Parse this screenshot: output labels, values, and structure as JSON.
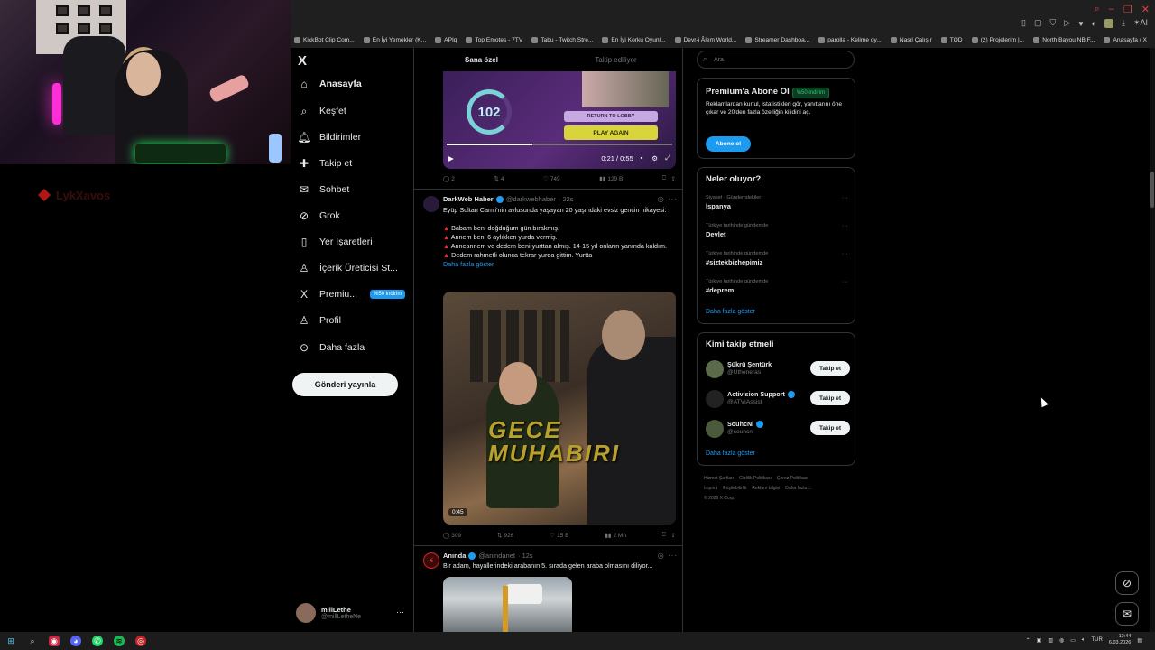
{
  "browser": {
    "bookmarks": [
      "KickBot Clip Com...",
      "En İyi Yemekler (K...",
      "APIq",
      "Top Emotes - 7TV",
      "Tabu - Twitch Stre...",
      "En İyi Korku Oyunl...",
      "Devr-i Âlem World...",
      "Streamer Dashboa...",
      "parolla - Kelime oy...",
      "Nasıl Çalışır",
      "TOD",
      "(2) Projelerim |...",
      "North Bayou NB F...",
      "Anasayfa / X"
    ]
  },
  "stream": {
    "logo_text": "LykXavos"
  },
  "nav": {
    "logo": "X",
    "items": [
      {
        "label": "Anasayfa",
        "icon": "home-icon"
      },
      {
        "label": "Keşfet",
        "icon": "search-icon"
      },
      {
        "label": "Bildirimler",
        "icon": "bell-icon"
      },
      {
        "label": "Takip et",
        "icon": "follow-icon"
      },
      {
        "label": "Sohbet",
        "icon": "mail-icon"
      },
      {
        "label": "Grok",
        "icon": "grok-icon"
      },
      {
        "label": "Yer İşaretleri",
        "icon": "bookmark-icon"
      },
      {
        "label": "İçerik Üreticisi St...",
        "icon": "creator-icon"
      },
      {
        "label": "Premiu...",
        "icon": "x-icon",
        "badge": "%50 indirim"
      },
      {
        "label": "Profil",
        "icon": "profile-icon"
      },
      {
        "label": "Daha fazla",
        "icon": "more-icon"
      }
    ],
    "post_button": "Gönderi yayınla",
    "account": {
      "name": "millLethe",
      "handle": "@millLetheNe",
      "more": "···"
    }
  },
  "feed": {
    "tabs": [
      {
        "label": "Sana özel",
        "active": true
      },
      {
        "label": "Takip ediliyor",
        "active": false
      }
    ],
    "video1": {
      "score": "102",
      "return_label": "RETURN TO LOBBY",
      "play_label": "PLAY AGAIN",
      "time": "0:21 / 0:55",
      "progress": 0.38
    },
    "post1_actions": {
      "replies": "2",
      "reposts": "4",
      "likes": "749",
      "views": "129 B"
    },
    "post2": {
      "name": "DarkWeb Haber",
      "handle": "@darkwebhaber",
      "time": "· 22s",
      "text_intro": "Eyüp Sultan Camii'nin avlusunda yaşayan 20 yaşındaki evsiz gencin hikayesi:",
      "lines": [
        "Babam beni doğduğum gün bırakmış.",
        "Annem beni 6 aylıkken yurda vermiş.",
        "Anneannem ve dedem beni yurttan almış. 14-15 yıl onların yanında kaldım.",
        "Dedem rahmetli olunca tekrar yurda gittim. Yurtta"
      ],
      "more": "Daha fazla göster",
      "video_title": "GECE MUHABIRI",
      "video_time": "0:45",
      "actions": {
        "replies": "309",
        "reposts": "926",
        "likes": "15 B",
        "views": "2 Mn"
      }
    },
    "post3": {
      "name": "Anında",
      "handle": "@anindanet",
      "time": "· 12s",
      "text": "Bir adam, hayallerindeki arabanın 5. sırada gelen araba olmasını diliyor..."
    }
  },
  "sidebar": {
    "search_placeholder": "Ara",
    "premium": {
      "title": "Premium'a Abone Ol",
      "badge": "%50 indirim",
      "text": "Reklamlardan kurtul, istatistikleri gör, yanıtlarını öne çıkar ve 20'den fazla özelliğin kilidini aç.",
      "button": "Abone ol"
    },
    "trends": {
      "title": "Neler oluyor?",
      "items": [
        {
          "context": "Siyaset · Gündemdekiler",
          "topic": "İspanya"
        },
        {
          "context": "Türkiye tarihinde gündemde",
          "topic": "Devlet"
        },
        {
          "context": "Türkiye tarihinde gündemde",
          "topic": "#siztekbizhepimiz"
        },
        {
          "context": "Türkiye tarihinde gündemde",
          "topic": "#deprem"
        }
      ],
      "more": "Daha fazla göster"
    },
    "who_to_follow": {
      "title": "Kimi takip etmeli",
      "items": [
        {
          "name": "Şükrü Şentürk",
          "handle": "@Utheneras",
          "verified": false,
          "button": "Takip et"
        },
        {
          "name": "Activision Support",
          "handle": "@ATVIAssist",
          "verified": true,
          "button": "Takip et"
        },
        {
          "name": "SouhcNi",
          "handle": "@souhcni",
          "verified": true,
          "button": "Takip et"
        }
      ],
      "more": "Daha fazla göster"
    },
    "footer": [
      "Hizmet Şartları",
      "Gizlilik Politikası",
      "Çerez Politikası",
      "Imprint",
      "Erişilebilirlik",
      "Reklam bilgisi",
      "Daha fazla ...",
      "© 2026 X Corp."
    ]
  },
  "taskbar": {
    "time": "12:44",
    "date": "6.03.2026",
    "lang": "TUR"
  },
  "colors": {
    "accent": "#1d9bf0",
    "bg": "#000000",
    "border": "#2f3336"
  }
}
